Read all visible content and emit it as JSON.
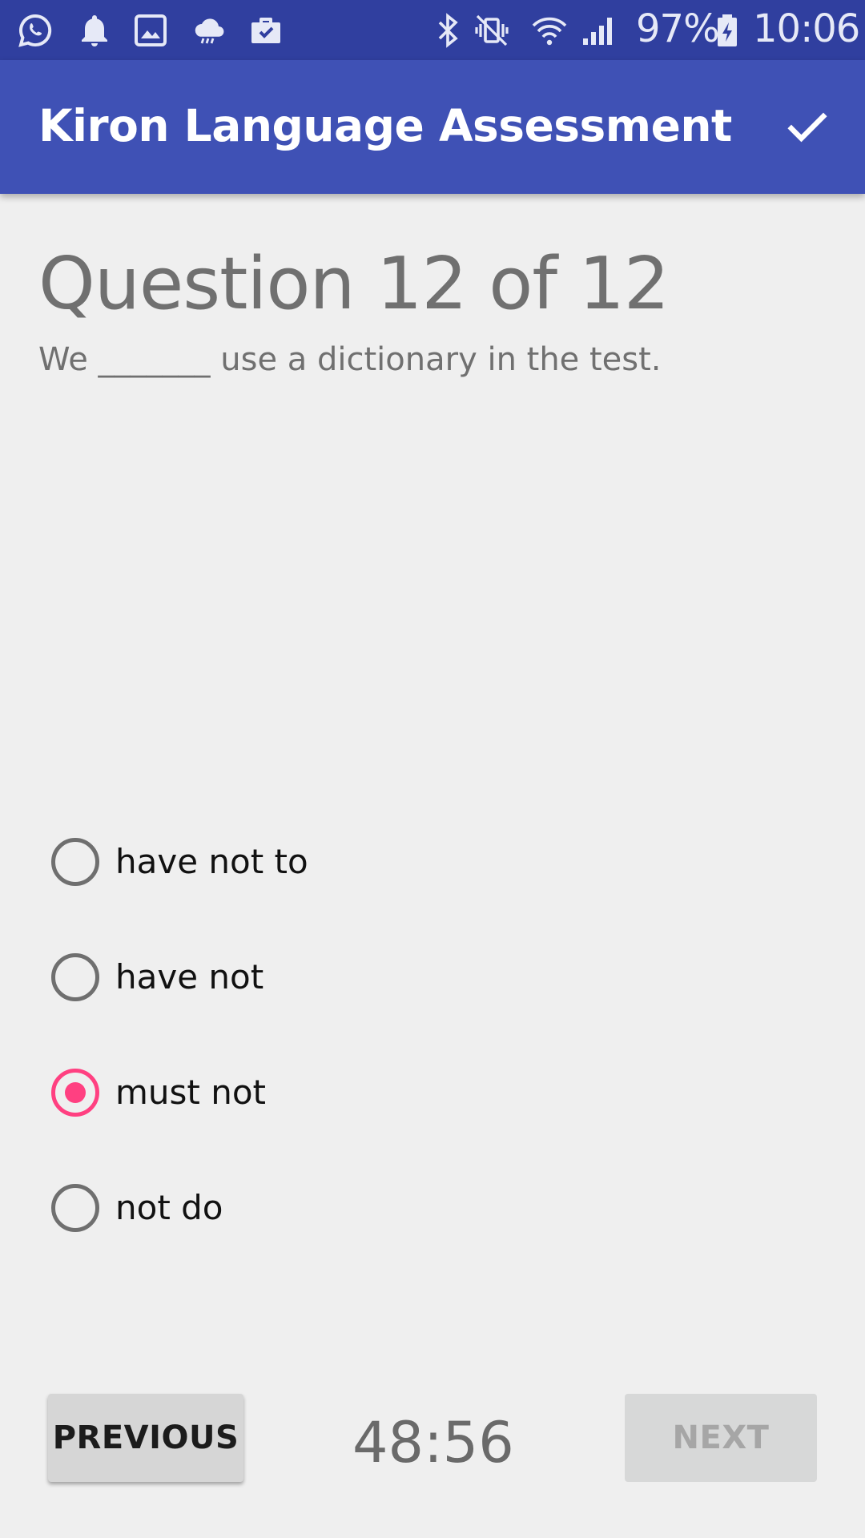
{
  "status_bar": {
    "battery_text": "97%",
    "time": "10:06",
    "icons": [
      "whatsapp-icon",
      "notification-bell-icon",
      "gallery-icon",
      "weather-icon",
      "briefcase-check-icon",
      "bluetooth-icon",
      "mute-vibrate-icon",
      "wifi-icon",
      "signal-icon",
      "battery-charging-icon"
    ]
  },
  "app_bar": {
    "title": "Kiron Language Assessment",
    "action_icon": "check-icon"
  },
  "question": {
    "heading": "Question 12 of 12",
    "text": "We _______ use a dictionary in the test."
  },
  "options": [
    {
      "label": "have not to",
      "selected": false
    },
    {
      "label": "have not",
      "selected": false
    },
    {
      "label": "must not",
      "selected": true
    },
    {
      "label": "not do",
      "selected": false
    }
  ],
  "footer": {
    "previous_label": "PREVIOUS",
    "timer": "48:56",
    "next_label": "NEXT"
  },
  "colors": {
    "status_bar": "#303f9f",
    "app_bar": "#3f51b5",
    "accent": "#ff4081",
    "background": "#efefef"
  }
}
